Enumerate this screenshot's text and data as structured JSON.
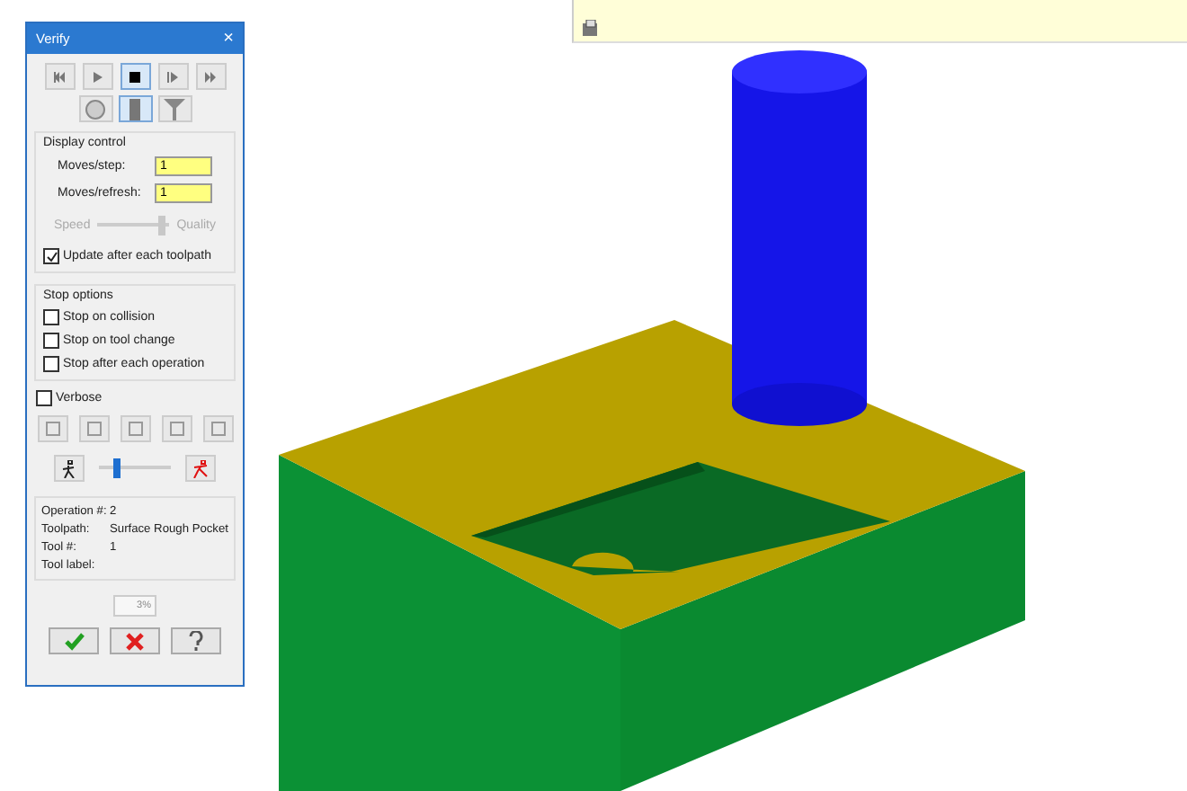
{
  "dialog": {
    "title": "Verify",
    "close": "×"
  },
  "display_control": {
    "title": "Display control",
    "fields": [
      {
        "label": "Moves/step:",
        "value": "1"
      },
      {
        "label": "Moves/refresh:",
        "value": "1"
      }
    ],
    "speed_label": "Speed",
    "quality_label": "Quality",
    "speed_quality": {
      "level": 0.9,
      "disabled": true
    },
    "update_after_toolpath": {
      "label": "Update after each toolpath",
      "checked": true
    }
  },
  "stop_options": {
    "title": "Stop options",
    "items": [
      {
        "label": "Stop on collision",
        "checked": false
      },
      {
        "label": "Stop on tool change",
        "checked": false
      },
      {
        "label": "Stop after each operation",
        "checked": false
      }
    ]
  },
  "verbose": {
    "label": "Verbose",
    "checked": false
  },
  "speed_slider": {
    "level": 0.25
  },
  "info": [
    {
      "label": "Operation #:",
      "value": "2"
    },
    {
      "label": "Toolpath:",
      "value": "Surface Rough Pocket"
    },
    {
      "label": "Tool #:",
      "value": "1"
    },
    {
      "label": "Tool label:"
    }
  ],
  "progress": {
    "text": "3%"
  }
}
